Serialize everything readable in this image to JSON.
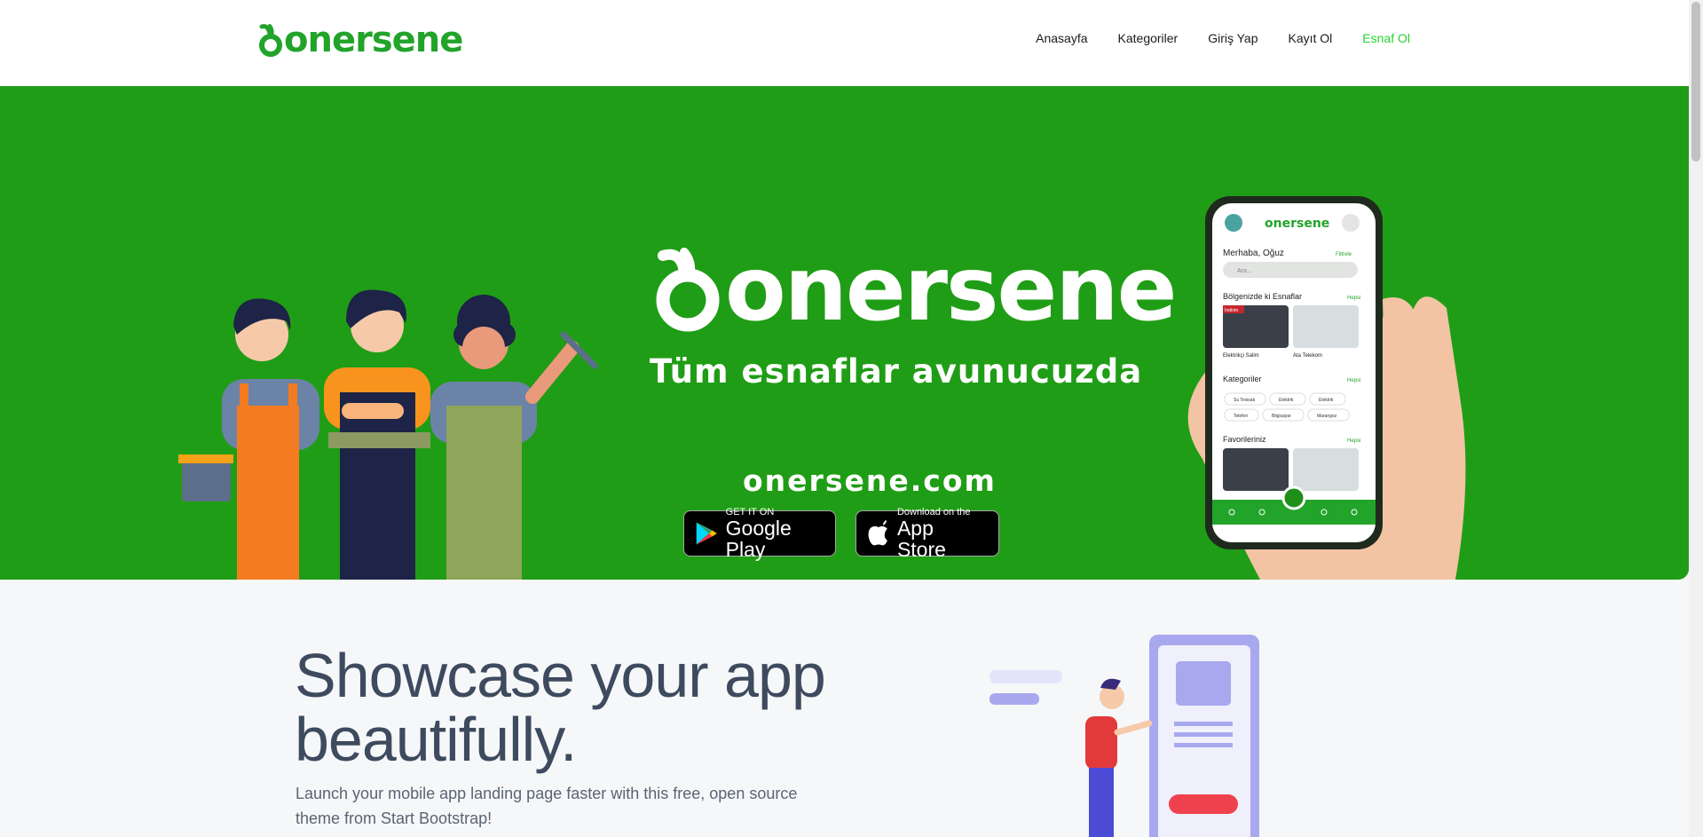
{
  "navbar": {
    "brand": "onersene",
    "links": [
      "Anasayfa",
      "Kategoriler",
      "Giriş Yap",
      "Kayıt Ol",
      "Esnaf Ol"
    ]
  },
  "hero": {
    "logo": "onersene",
    "tagline": "Tüm esnaflar avunucuzda",
    "domain": "onersene.com",
    "google_play": {
      "small": "GET IT ON",
      "big": "Google Play"
    },
    "app_store": {
      "small": "Download on the",
      "big": "App Store"
    }
  },
  "phone": {
    "brand": "onersene",
    "greeting": "Merhaba, Oğuz",
    "filter": "Filtrele",
    "search_placeholder": "Ara...",
    "section_nearby": "Bölgenizde ki Esnaflar",
    "see_all": "Hepsi",
    "nearby_cards": [
      "Elektrikçi Salim",
      "Ata Telekom"
    ],
    "nearby_badge": "İndirim",
    "section_categories": "Kategoriler",
    "categories": [
      "Su Tesisatı",
      "Elektrik",
      "Elektrik",
      "Telefon",
      "Bilgisayar",
      "Marangoz"
    ],
    "section_favorites": "Favorileriniz"
  },
  "showcase": {
    "title_line1": "Showcase your app",
    "title_line2": "beautifully.",
    "subtitle": "Launch your mobile app landing page faster with this free, open source theme from Start Bootstrap!"
  },
  "colors": {
    "brand_green": "#209d16",
    "accent_green": "#24d32e",
    "text_dark": "#3e4a5e"
  }
}
